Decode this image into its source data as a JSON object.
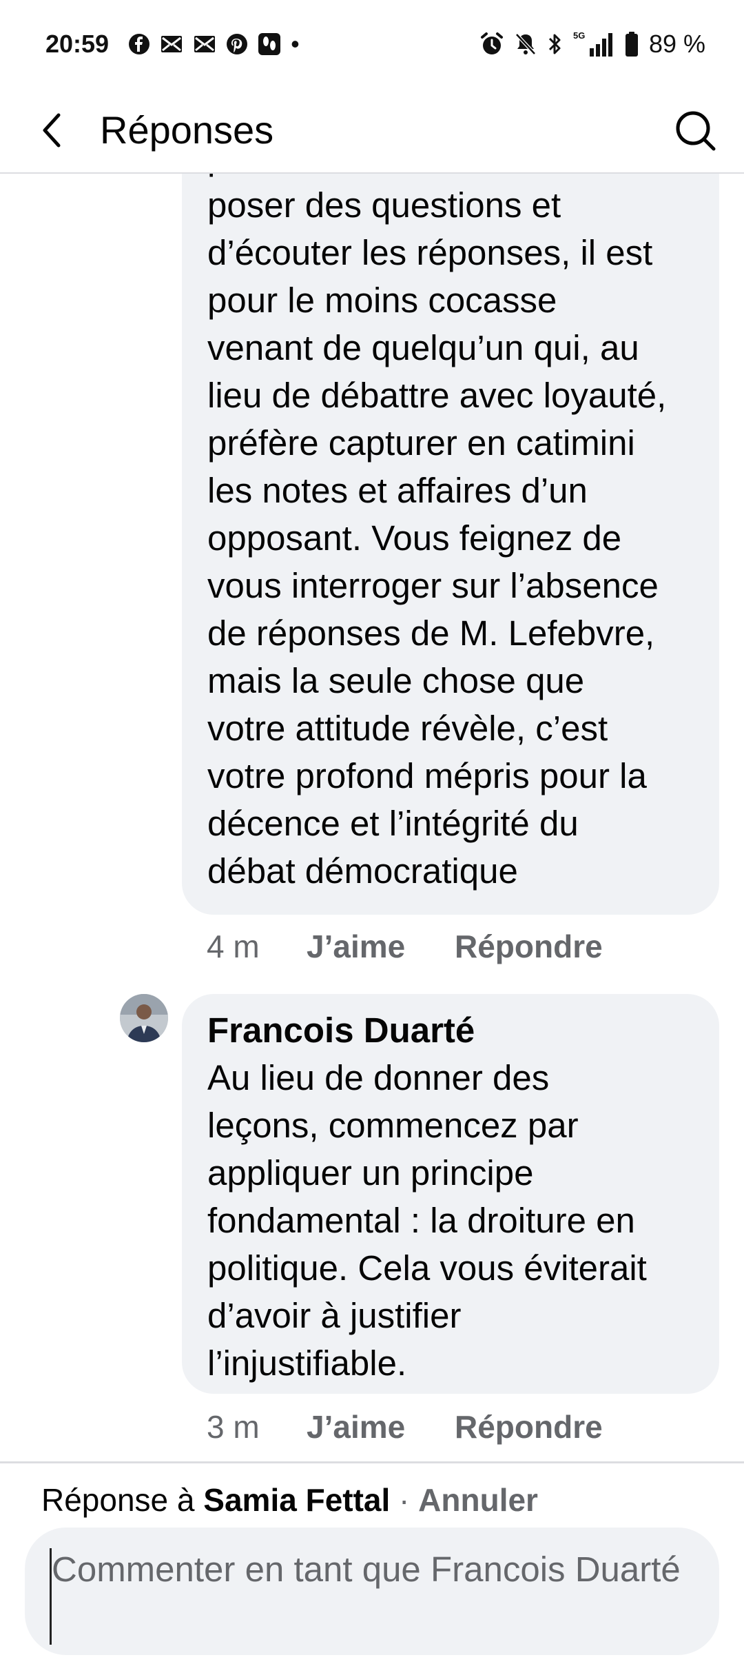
{
  "status_bar": {
    "time": "20:59",
    "dot": "•",
    "network": "5G",
    "battery": "89 %",
    "left_icons": [
      "facebook-icon",
      "mail-icon",
      "mail-icon",
      "pinterest-icon",
      "footprints-icon"
    ],
    "right_icons": [
      "alarm-icon",
      "bell-muted-icon",
      "bluetooth-icon",
      "signal-icon",
      "battery-icon"
    ]
  },
  "header": {
    "title": "Réponses",
    "back_icon": "chevron-left-icon",
    "search_icon": "search-icon"
  },
  "comments": [
    {
      "author": "",
      "lines": [
        "paternaliste sur l'art de",
        "poser des questions et",
        "d’écouter les réponses, il est",
        "pour le moins cocasse",
        "venant de quelqu’un qui, au",
        "lieu de débattre avec loyauté,",
        "préfère capturer en catimini",
        "les notes et affaires d’un",
        "opposant. Vous feignez de",
        "vous interroger sur l’absence",
        "de réponses de M. Lefebvre,",
        "mais la seule chose que",
        "votre attitude révèle, c’est",
        "votre profond mépris pour la",
        "décence et l’intégrité du",
        "débat démocratique"
      ],
      "time": "4 m",
      "like_label": "J’aime",
      "reply_label": "Répondre"
    },
    {
      "author": "Francois Duarté",
      "lines": [
        "Au lieu de donner des",
        "leçons, commencez par",
        "appliquer un principe",
        "fondamental : la droiture en",
        "politique. Cela vous éviterait",
        "d’avoir à justifier",
        "l’injustifiable."
      ],
      "time": "3 m",
      "like_label": "J’aime",
      "reply_label": "Répondre"
    }
  ],
  "reply_bar": {
    "prefix": "Réponse à ",
    "target_name": "Samia Fettal",
    "separator": " · ",
    "cancel_label": "Annuler",
    "input_placeholder": "Commenter en tant que Francois Duarté",
    "input_value": ""
  },
  "colors": {
    "bubble_bg": "#f0f2f5",
    "secondary_text": "#65676b",
    "divider": "#dcdde1"
  }
}
